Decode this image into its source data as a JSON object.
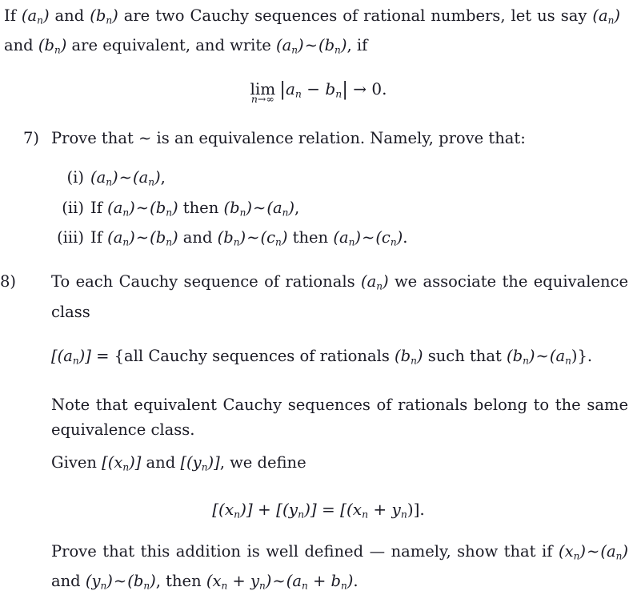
{
  "document": {
    "type": "mathematics-exercise-sheet",
    "topic": "Cauchy sequences of rational numbers and equivalence classes",
    "text_color": "#1a1a24",
    "background_color": "#ffffff"
  },
  "intro": {
    "line1_a": "If ",
    "seq_a": "a",
    "sub_n": "n",
    "line1_b": " and ",
    "seq_b": "b",
    "line1_c": " are two Cauchy sequences of rational numbers, let us say",
    "line2_a": " and ",
    "line2_b": " are equivalent, and write ",
    "sim": "∼",
    "line2_c": ", if"
  },
  "limit_equation": {
    "operator": "lim",
    "subscript_var": "n",
    "subscript_arrow": "→",
    "subscript_limit": "∞",
    "abs_open": "|",
    "term_a": "a",
    "minus": "−",
    "term_b": "b",
    "abs_close": "|",
    "arrow": "→",
    "value": "0."
  },
  "items": [
    {
      "number": "7)",
      "text": "Prove that ∼ is an equivalence relation. Namely, prove that:",
      "subitems": [
        {
          "label": "(i)",
          "seq_left": "a",
          "relation": "∼",
          "seq_right": "a",
          "prefix": "",
          "suffix": ","
        },
        {
          "label": "(ii)",
          "prefix": "If ",
          "seq_1": "a",
          "rel_1": "∼",
          "seq_2": "b",
          "middle": " then ",
          "seq_3": "b",
          "rel_2": "∼",
          "seq_4": "a",
          "suffix": ","
        },
        {
          "label": "(iii)",
          "prefix": "If ",
          "seq_1": "a",
          "rel_1": "∼",
          "seq_2": "b",
          "middle": " and ",
          "seq_3": "b",
          "rel_2": "∼",
          "seq_4": "c",
          "middle2": " then ",
          "seq_5": "a",
          "rel_3": "∼",
          "seq_6": "c",
          "suffix": "."
        }
      ]
    },
    {
      "number": "8)",
      "text_line1": "To each Cauchy sequence of rationals ",
      "text_seq": "a",
      "text_line2": " we associate the equivalence",
      "text_line3": "class"
    }
  ],
  "class_equation": {
    "bracket_open": "[(",
    "var": "a",
    "sub": "n",
    "bracket_close": ")]",
    "equals": "=",
    "set_open": "{",
    "set_text": "all Cauchy sequences of rationals ",
    "set_var_b": "b",
    "set_text2": " such that ",
    "set_var_b2": "b",
    "sim": "∼",
    "set_var_a": "a",
    "set_close": ")}."
  },
  "note": {
    "text": "Note that equivalent Cauchy sequences of rationals belong to the same equivalence class."
  },
  "given": {
    "prefix": "Given ",
    "var_x": "x",
    "sub": "n",
    "middle": " and ",
    "var_y": "y",
    "suffix": ", we define"
  },
  "addition_equation": {
    "left_open": "[(",
    "var_x": "x",
    "sub": "n",
    "left_close": ")]",
    "plus": "+",
    "var_y": "y",
    "equals": "=",
    "sum_open": "[(",
    "sum_x": "x",
    "sum_plus": "+",
    "sum_y": "y",
    "sum_close": ")].",
    "full": "[(x_n)] + [(y_n)] = [(x_n + y_n)]."
  },
  "well_defined": {
    "text_a": "Prove that this addition is well defined ",
    "dash": "—",
    "text_b": " namely, show that if ",
    "var_x": "x",
    "sim": "∼",
    "var_a": "a",
    "text_c": " and ",
    "var_y": "y",
    "var_b": "b",
    "text_d": ", then ",
    "text_e": "."
  }
}
